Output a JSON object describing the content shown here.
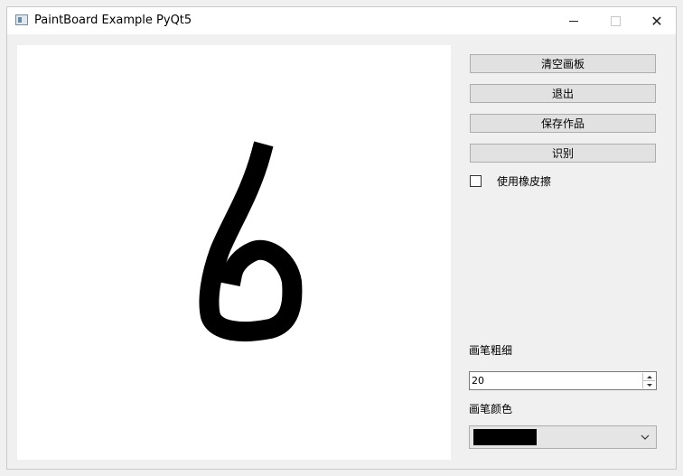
{
  "window": {
    "title": "PaintBoard Example PyQt5",
    "app_icon": "window-app-icon",
    "controls": {
      "minimize": "minimize-icon",
      "maximize": "maximize-icon",
      "close": "close-icon",
      "close_glyph": "✕"
    }
  },
  "canvas": {
    "background": "#ffffff",
    "stroke_color": "#000000",
    "drawing": "handwritten digit 6"
  },
  "buttons": {
    "clear": "清空画板",
    "quit": "退出",
    "save": "保存作品",
    "recognize": "识别"
  },
  "eraser": {
    "label": "使用橡皮擦",
    "checked": false
  },
  "pen_width": {
    "label": "画笔粗细",
    "value": "20"
  },
  "pen_color": {
    "label": "画笔颜色",
    "selected": "#000000"
  },
  "colors": {
    "window_bg": "#f0f0f0",
    "button_bg": "#e1e1e1",
    "button_border": "#adadad"
  }
}
